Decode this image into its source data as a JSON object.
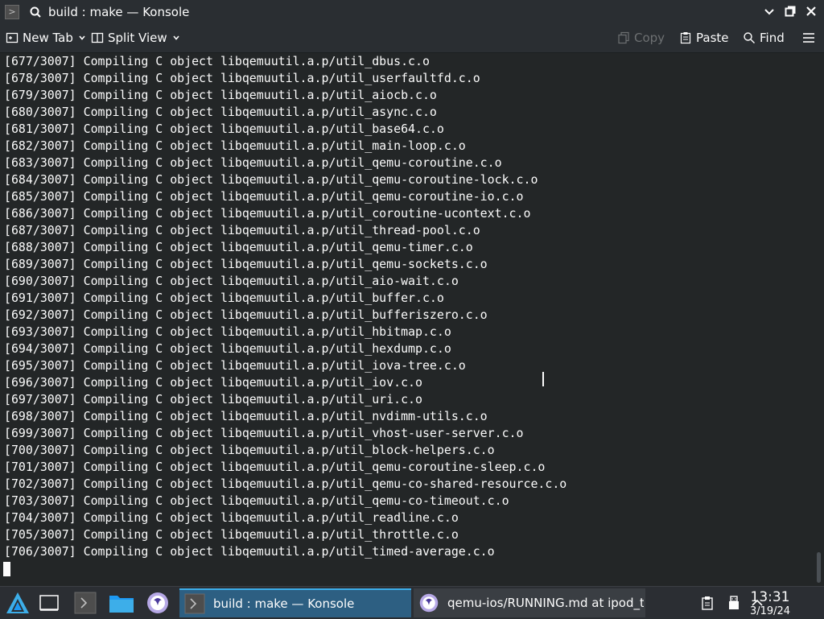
{
  "window": {
    "title": "build : make — Konsole"
  },
  "toolbar": {
    "new_tab": "New Tab",
    "split_view": "Split View",
    "copy": "Copy",
    "paste": "Paste",
    "find": "Find"
  },
  "terminal": {
    "lines": [
      "[677/3007] Compiling C object libqemuutil.a.p/util_dbus.c.o",
      "[678/3007] Compiling C object libqemuutil.a.p/util_userfaultfd.c.o",
      "[679/3007] Compiling C object libqemuutil.a.p/util_aiocb.c.o",
      "[680/3007] Compiling C object libqemuutil.a.p/util_async.c.o",
      "[681/3007] Compiling C object libqemuutil.a.p/util_base64.c.o",
      "[682/3007] Compiling C object libqemuutil.a.p/util_main-loop.c.o",
      "[683/3007] Compiling C object libqemuutil.a.p/util_qemu-coroutine.c.o",
      "[684/3007] Compiling C object libqemuutil.a.p/util_qemu-coroutine-lock.c.o",
      "[685/3007] Compiling C object libqemuutil.a.p/util_qemu-coroutine-io.c.o",
      "[686/3007] Compiling C object libqemuutil.a.p/util_coroutine-ucontext.c.o",
      "[687/3007] Compiling C object libqemuutil.a.p/util_thread-pool.c.o",
      "[688/3007] Compiling C object libqemuutil.a.p/util_qemu-timer.c.o",
      "[689/3007] Compiling C object libqemuutil.a.p/util_qemu-sockets.c.o",
      "[690/3007] Compiling C object libqemuutil.a.p/util_aio-wait.c.o",
      "[691/3007] Compiling C object libqemuutil.a.p/util_buffer.c.o",
      "[692/3007] Compiling C object libqemuutil.a.p/util_bufferiszero.c.o",
      "[693/3007] Compiling C object libqemuutil.a.p/util_hbitmap.c.o",
      "[694/3007] Compiling C object libqemuutil.a.p/util_hexdump.c.o",
      "[695/3007] Compiling C object libqemuutil.a.p/util_iova-tree.c.o",
      "[696/3007] Compiling C object libqemuutil.a.p/util_iov.c.o",
      "[697/3007] Compiling C object libqemuutil.a.p/util_uri.c.o",
      "[698/3007] Compiling C object libqemuutil.a.p/util_nvdimm-utils.c.o",
      "[699/3007] Compiling C object libqemuutil.a.p/util_vhost-user-server.c.o",
      "[700/3007] Compiling C object libqemuutil.a.p/util_block-helpers.c.o",
      "[701/3007] Compiling C object libqemuutil.a.p/util_qemu-coroutine-sleep.c.o",
      "[702/3007] Compiling C object libqemuutil.a.p/util_qemu-co-shared-resource.c.o",
      "[703/3007] Compiling C object libqemuutil.a.p/util_qemu-co-timeout.c.o",
      "[704/3007] Compiling C object libqemuutil.a.p/util_readline.c.o",
      "[705/3007] Compiling C object libqemuutil.a.p/util_throttle.c.o",
      "[706/3007] Compiling C object libqemuutil.a.p/util_timed-average.c.o"
    ]
  },
  "taskbar": {
    "tasks": [
      {
        "label": "build : make — Konsole",
        "active": true
      },
      {
        "label": "qemu-ios/RUNNING.md at ipod_to…",
        "active": false
      }
    ],
    "clock": {
      "time": "13:31",
      "date": "3/19/24"
    }
  },
  "colors": {
    "accent": "#3daee9",
    "terminal_bg": "#232627",
    "chrome_bg": "#2a2e32"
  }
}
